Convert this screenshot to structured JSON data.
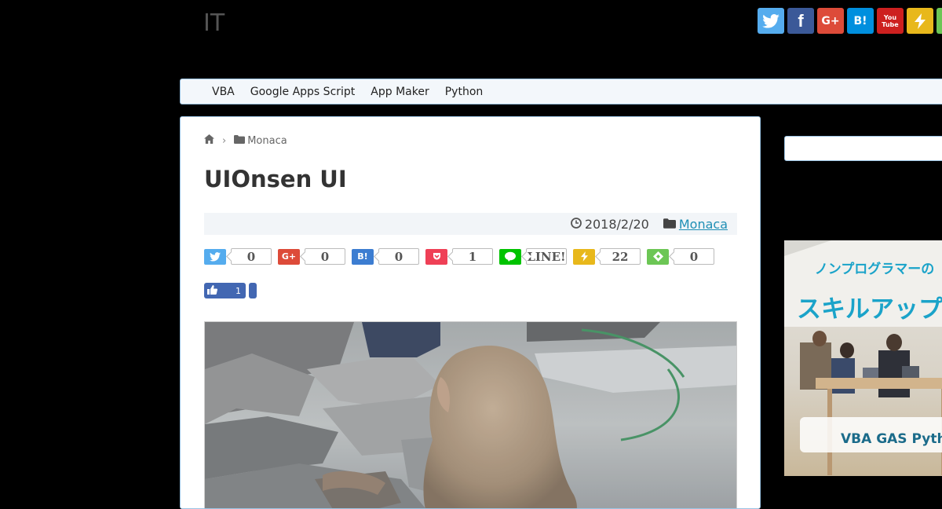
{
  "header": {
    "site_title": "IT",
    "social_icons": [
      {
        "name": "twitter-icon",
        "glyph": "🐦",
        "color": "#55acee"
      },
      {
        "name": "facebook-icon",
        "glyph": "f",
        "color": "#3b5998"
      },
      {
        "name": "google-plus-icon",
        "glyph": "G+",
        "color": "#dd4b39"
      },
      {
        "name": "hatena-bookmark-icon",
        "glyph": "B!",
        "color": "#008fde"
      },
      {
        "name": "youtube-icon",
        "glyph": "You Tube",
        "color": "#cd201f"
      },
      {
        "name": "feedly-lightning-icon",
        "glyph": "⚡",
        "color": "#e8b81b"
      }
    ]
  },
  "nav": {
    "items": [
      "VBA",
      "Google Apps Script",
      "App Maker",
      "Python"
    ]
  },
  "breadcrumb": {
    "category": "Monaca"
  },
  "article": {
    "title": "UIOnsen UI",
    "date": "2018/2/20",
    "category": "Monaca"
  },
  "share": {
    "buttons": [
      {
        "name": "twitter",
        "glyph": "🐦",
        "color": "#55acee",
        "count": "0"
      },
      {
        "name": "google-plus",
        "glyph": "G+",
        "color": "#dd4b39",
        "count": "0"
      },
      {
        "name": "hatena",
        "glyph": "B!",
        "color": "#3c7dd1",
        "count": "0"
      },
      {
        "name": "pocket",
        "glyph": "♥",
        "color": "#ef4056",
        "count": "1"
      },
      {
        "name": "line",
        "glyph": "☰",
        "color": "#00c300",
        "count": "LINE!"
      },
      {
        "name": "feedly",
        "glyph": "⚡",
        "color": "#e8b81b",
        "count": "22"
      },
      {
        "name": "feedly-follow",
        "glyph": "❖",
        "color": "#6cc655",
        "count": "0"
      }
    ],
    "facebook_like_count": "1"
  },
  "sidebar": {
    "ad_heading": "ノンプログラマーの",
    "ad_title": "スキルアップ",
    "ad_footer": "VBA GAS Pytho"
  },
  "colors": {
    "background": "#000000",
    "panel_border": "#9cc4e4",
    "link": "#1f8fb5"
  }
}
